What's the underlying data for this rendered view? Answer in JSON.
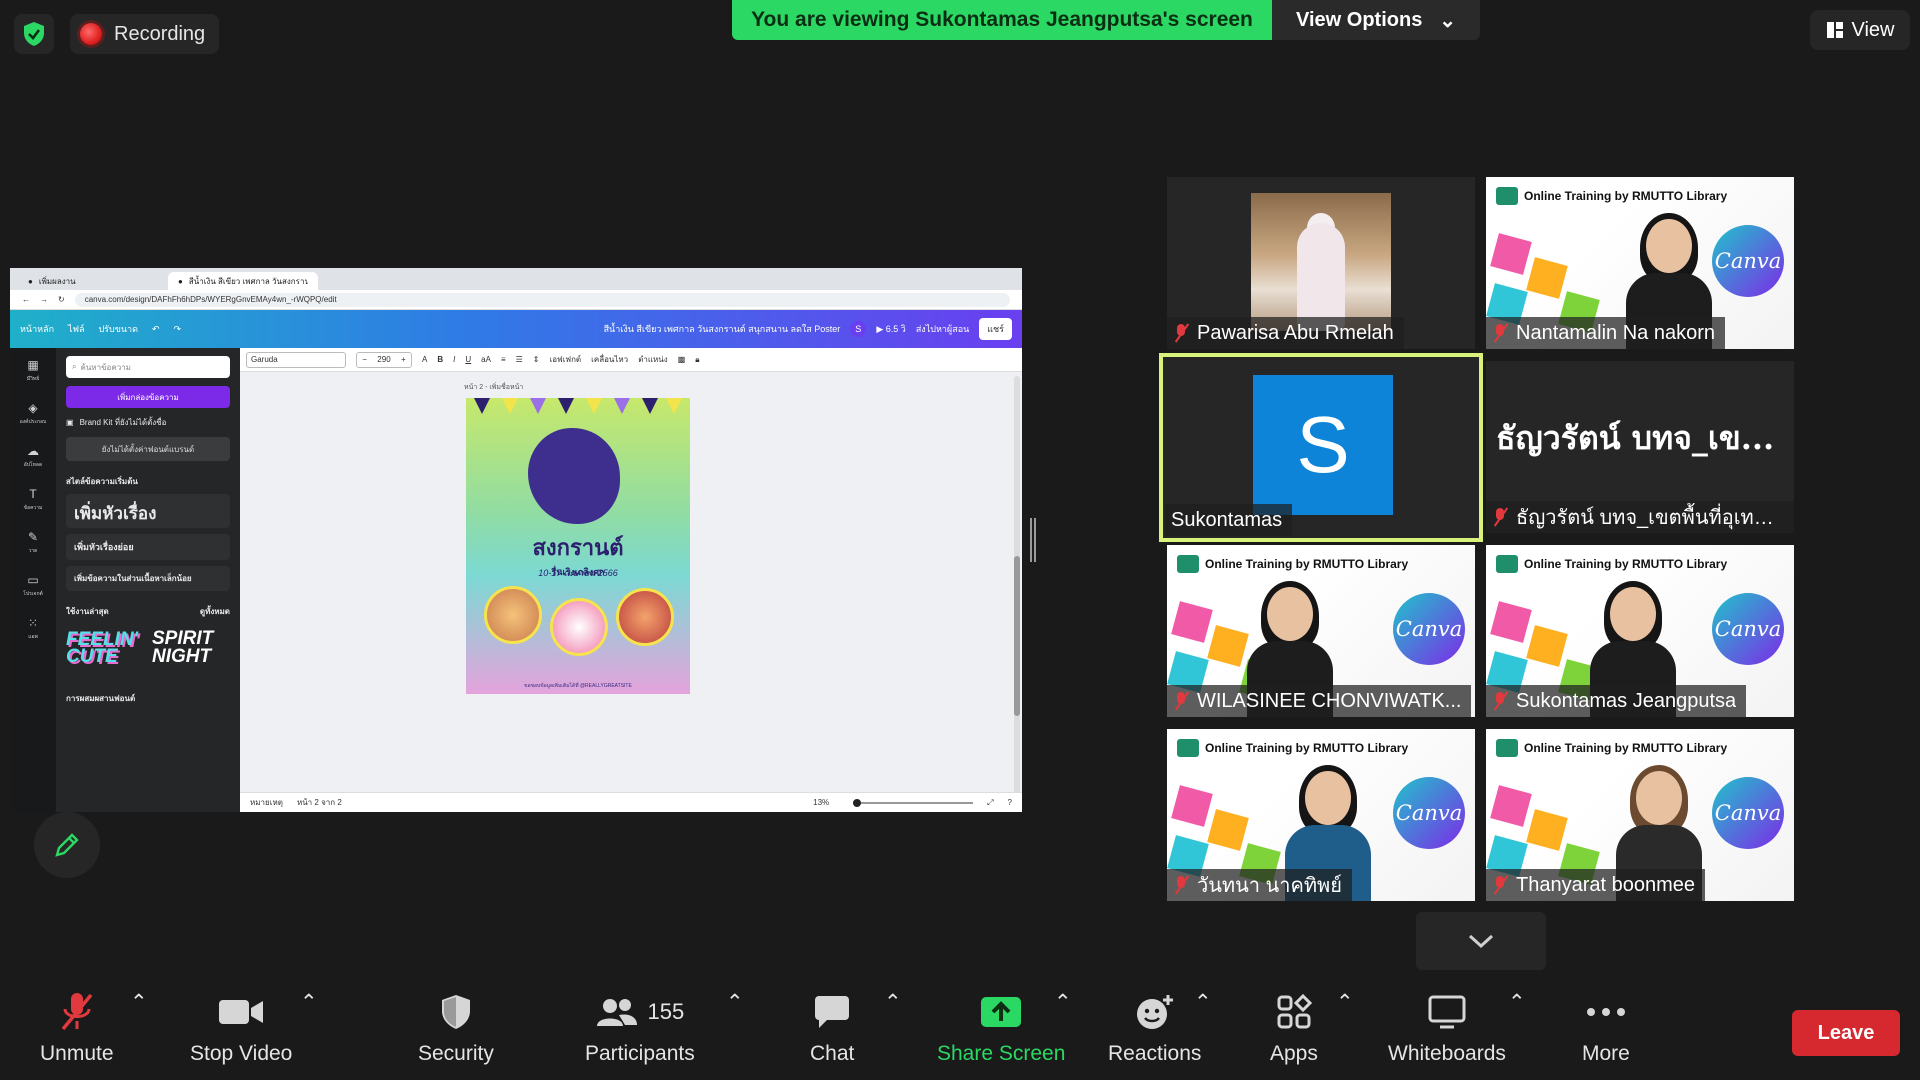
{
  "top": {
    "recording_label": "Recording",
    "viewing_text": "You are viewing Sukontamas Jeangputsa's screen",
    "view_options_label": "View Options",
    "view_label": "View"
  },
  "shared_screen": {
    "tabs": [
      "เพิ่มผลงาน",
      "สีน้ำเงิน สีเขียว เพศกาล วันสงกรานต์ ส..."
    ],
    "url": "canva.com/design/DAFhFh6hDPs/WYERgGnvEMAy4wn_-rWQPQ/edit",
    "canva_top": {
      "home": "หน้าหลัก",
      "file": "ไฟล์",
      "resize": "ปรับขนาด",
      "doc_title": "สีน้ำเงิน สีเขียว เพศกาล วันสงกรานต์ สนุกสนาน ลดใส Poster",
      "avatar": "S",
      "play": "6.5 วิ",
      "present": "ส่งไปหาผู้สอน",
      "share": "แชร์"
    },
    "rail": [
      "มีวิทย์",
      "องค์ประกอบ",
      "อัปโหลด",
      "ข้อความ",
      "วาด",
      "โปรเจกต์",
      "แอพ"
    ],
    "panel": {
      "search_placeholder": "ค้นหาข้อความ",
      "add_textbox": "เพิ่มกล่องข้อความ",
      "brand_kit": "Brand Kit ที่ยังไม่ได้ตั้งชื่อ",
      "edit_brand": "ยังไม่ได้ตั้งค่าฟอนต์แบรนด์",
      "default_styles": "สไตล์ข้อความเริ่มต้น",
      "heading": "เพิ่มหัวเรื่อง",
      "subheading": "เพิ่มหัวเรื่องย่อย",
      "body": "เพิ่มข้อความในส่วนเนื้อหาเล็กน้อย",
      "recently_used": "ใช้งานล่าสุด",
      "see_all": "ดูทั้งหมด",
      "font1": "FEELIN' CUTE",
      "font2": "SPIRIT NIGHT",
      "font_combos": "การผสมผสานฟอนต์"
    },
    "toolbar": {
      "font": "Garuda",
      "size": "290",
      "effects": "เอฟเฟกต์",
      "animate": "เคลื่อนไหว",
      "position": "ตำแหน่ง"
    },
    "page_label": "หน้า 2 - เพิ่มชื่อหน้า",
    "poster": {
      "title": "สงกรานต์",
      "subtitle": "รื่นเริงเถลิงศก",
      "date": "10-17 เมษายน 2566",
      "footer": "ขอขอบข้อมูลเพิ่มเติมได้ที่ @REALLYGREATSITE"
    },
    "status": {
      "notes": "หมายเหตุ",
      "page": "หน้า 2 จาก 2",
      "zoom": "13%"
    }
  },
  "participants": [
    {
      "name": "Pawarisa Abu Rmelah",
      "muted": true,
      "kind": "photo"
    },
    {
      "name": "Nantamalin Na nakorn",
      "muted": true,
      "kind": "canva"
    },
    {
      "name": "Sukontamas",
      "muted": false,
      "kind": "avatar",
      "avatar_letter": "S",
      "active": true
    },
    {
      "name": "ธัญวรัตน์ บทจ_เขตพื้นที่อุเทนถ...",
      "muted": true,
      "kind": "text",
      "display_text": "ธัญวรัตน์ บทจ_เข..."
    },
    {
      "name": "WILASINEE CHONVIWATK...",
      "muted": true,
      "kind": "canva"
    },
    {
      "name": "Sukontamas Jeangputsa",
      "muted": true,
      "kind": "canva"
    },
    {
      "name": "วันทนา นาคทิพย์",
      "muted": true,
      "kind": "canva"
    },
    {
      "name": "Thanyarat boonmee",
      "muted": true,
      "kind": "canva"
    }
  ],
  "canva_bg": {
    "banner": "Online Training by RMUTTO Library",
    "logo": "Canva"
  },
  "toolbar": {
    "unmute": "Unmute",
    "stop_video": "Stop Video",
    "security": "Security",
    "participants": "Participants",
    "participants_count": "155",
    "chat": "Chat",
    "share_screen": "Share Screen",
    "reactions": "Reactions",
    "apps": "Apps",
    "whiteboards": "Whiteboards",
    "more": "More",
    "leave": "Leave"
  },
  "colors": {
    "share_green": "#2bd864",
    "leave_red": "#d5282f",
    "active_speaker": "#d9f27b"
  }
}
